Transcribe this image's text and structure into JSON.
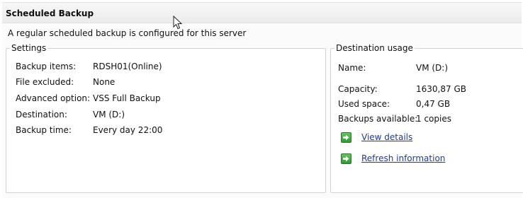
{
  "header": {
    "title": "Scheduled Backup"
  },
  "status": {
    "text": "A regular scheduled backup is configured for this server"
  },
  "settings": {
    "legend": "Settings",
    "rows": [
      {
        "label": "Backup items:",
        "value": "RDSH01(Online)"
      },
      {
        "label": "File excluded:",
        "value": "None"
      },
      {
        "label": "Advanced option:",
        "value": "VSS Full Backup"
      },
      {
        "label": "Destination:",
        "value": "VM (D:)"
      },
      {
        "label": "Backup time:",
        "value": "Every day 22:00"
      }
    ]
  },
  "destination": {
    "legend": "Destination usage",
    "name_label": "Name:",
    "name_value": "VM (D:)",
    "capacity_label": "Capacity:",
    "capacity_value": "1630,87 GB",
    "used_label": "Used space:",
    "used_value": "0,47 GB",
    "backups_label": "Backups available:",
    "backups_value": "1 copies",
    "view_details": "View details",
    "refresh_information": "Refresh information"
  },
  "colors": {
    "link": "#1a3aa8",
    "arrow_icon": "#3aaa3a"
  }
}
